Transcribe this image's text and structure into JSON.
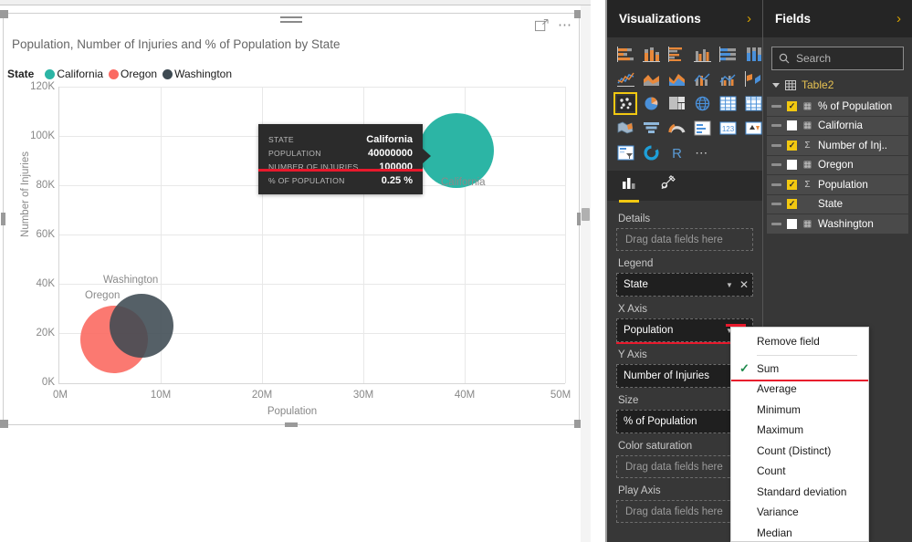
{
  "visual": {
    "title": "Population, Number of Injuries and % of Population by State",
    "focus_icon": "focus-mode-icon",
    "more_icon": "more-options-ellipsis-icon",
    "legend_title": "State"
  },
  "chart_data": {
    "type": "scatter",
    "title": "Population, Number of Injuries and % of Population by State",
    "xlabel": "Population",
    "ylabel": "Number of Injuries",
    "xlim": [
      0,
      50000000
    ],
    "ylim": [
      0,
      120000
    ],
    "xticks": [
      "0M",
      "10M",
      "20M",
      "30M",
      "40M",
      "50M"
    ],
    "yticks": [
      "0K",
      "20K",
      "40K",
      "60K",
      "80K",
      "100K",
      "120K"
    ],
    "grid": true,
    "legend_position": "top-left",
    "size_field": "% of Population",
    "series": [
      {
        "name": "California",
        "color": "#2CB5A5",
        "x": 40000000,
        "y": 100000,
        "size": 0.25,
        "label": "California"
      },
      {
        "name": "Oregon",
        "color": "#FB6A62",
        "x": 4000000,
        "y": 14000,
        "size": 0.35,
        "label": "Oregon"
      },
      {
        "name": "Washington",
        "color": "#3E4A52",
        "x": 6500000,
        "y": 19000,
        "size": 0.3,
        "label": "Washington"
      }
    ]
  },
  "tooltip": {
    "rows": [
      {
        "key": "STATE",
        "value": "California"
      },
      {
        "key": "POPULATION",
        "value": "40000000"
      },
      {
        "key": "NUMBER OF INJURIES",
        "value": "100000"
      },
      {
        "key": "% OF POPULATION",
        "value": "0.25 %"
      }
    ]
  },
  "visualizations": {
    "header": "Visualizations",
    "chevron": "›",
    "icons": [
      "stacked-bar-chart-icon",
      "stacked-column-chart-icon",
      "clustered-bar-chart-icon",
      "clustered-column-chart-icon",
      "100-percent-stacked-bar-chart-icon",
      "100-percent-stacked-column-chart-icon",
      "line-chart-icon",
      "area-chart-icon",
      "stacked-area-chart-icon",
      "line-and-stacked-column-chart-icon",
      "line-and-clustered-column-chart-icon",
      "ribbon-chart-icon",
      "scatter-chart-icon",
      "pie-chart-icon",
      "treemap-icon",
      "map-icon",
      "table-icon",
      "matrix-icon",
      "filled-map-icon",
      "funnel-icon",
      "gauge-icon",
      "multi-row-card-icon",
      "card-icon",
      "kpi-icon",
      "slicer-icon",
      "donut-chart-icon",
      "r-script-visual-icon",
      "more-visuals-icon"
    ],
    "selected_icon": "scatter-chart-icon",
    "tabs": [
      {
        "name": "fields-tab",
        "icon": "bar-chart-icon",
        "active": true
      },
      {
        "name": "format-tab",
        "icon": "paintbrush-icon",
        "active": false
      }
    ],
    "wells": [
      {
        "label": "Details",
        "type": "drop",
        "placeholder": "Drag data fields here"
      },
      {
        "label": "Legend",
        "type": "chip",
        "value": "State"
      },
      {
        "label": "X Axis",
        "type": "chip",
        "value": "Population",
        "highlighted": true
      },
      {
        "label": "Y Axis",
        "type": "chip",
        "value": "Number of Injuries"
      },
      {
        "label": "Size",
        "type": "chip",
        "value": "% of Population"
      },
      {
        "label": "Color saturation",
        "type": "drop",
        "placeholder": "Drag data fields here"
      },
      {
        "label": "Play Axis",
        "type": "drop",
        "placeholder": "Drag data fields here"
      }
    ]
  },
  "context_menu": {
    "items": [
      {
        "label": "Remove field",
        "checked": false,
        "separator_after": true
      },
      {
        "label": "Sum",
        "checked": true,
        "highlighted": true
      },
      {
        "label": "Average",
        "checked": false
      },
      {
        "label": "Minimum",
        "checked": false
      },
      {
        "label": "Maximum",
        "checked": false
      },
      {
        "label": "Count (Distinct)",
        "checked": false
      },
      {
        "label": "Count",
        "checked": false
      },
      {
        "label": "Standard deviation",
        "checked": false
      },
      {
        "label": "Variance",
        "checked": false
      },
      {
        "label": "Median",
        "checked": false
      }
    ]
  },
  "fields": {
    "header": "Fields",
    "chevron": "›",
    "search_placeholder": "Search",
    "search_value": "",
    "table_name": "Table2",
    "items": [
      {
        "label": "% of Population",
        "checked": true,
        "type_icon": "calculator-icon"
      },
      {
        "label": "California",
        "checked": false,
        "type_icon": "calculator-icon"
      },
      {
        "label": "Number of Inj..",
        "checked": true,
        "type_icon": "sigma-icon"
      },
      {
        "label": "Oregon",
        "checked": false,
        "type_icon": "calculator-icon"
      },
      {
        "label": "Population",
        "checked": true,
        "type_icon": "sigma-icon"
      },
      {
        "label": "State",
        "checked": true,
        "type_icon": ""
      },
      {
        "label": "Washington",
        "checked": false,
        "type_icon": "calculator-icon"
      }
    ]
  },
  "colors": {
    "accent_yellow": "#F2C811",
    "annotation_red": "#E8192C",
    "california": "#2CB5A5",
    "oregon": "#FB6A62",
    "washington": "#3E4A52",
    "panel_bg": "#373737"
  }
}
